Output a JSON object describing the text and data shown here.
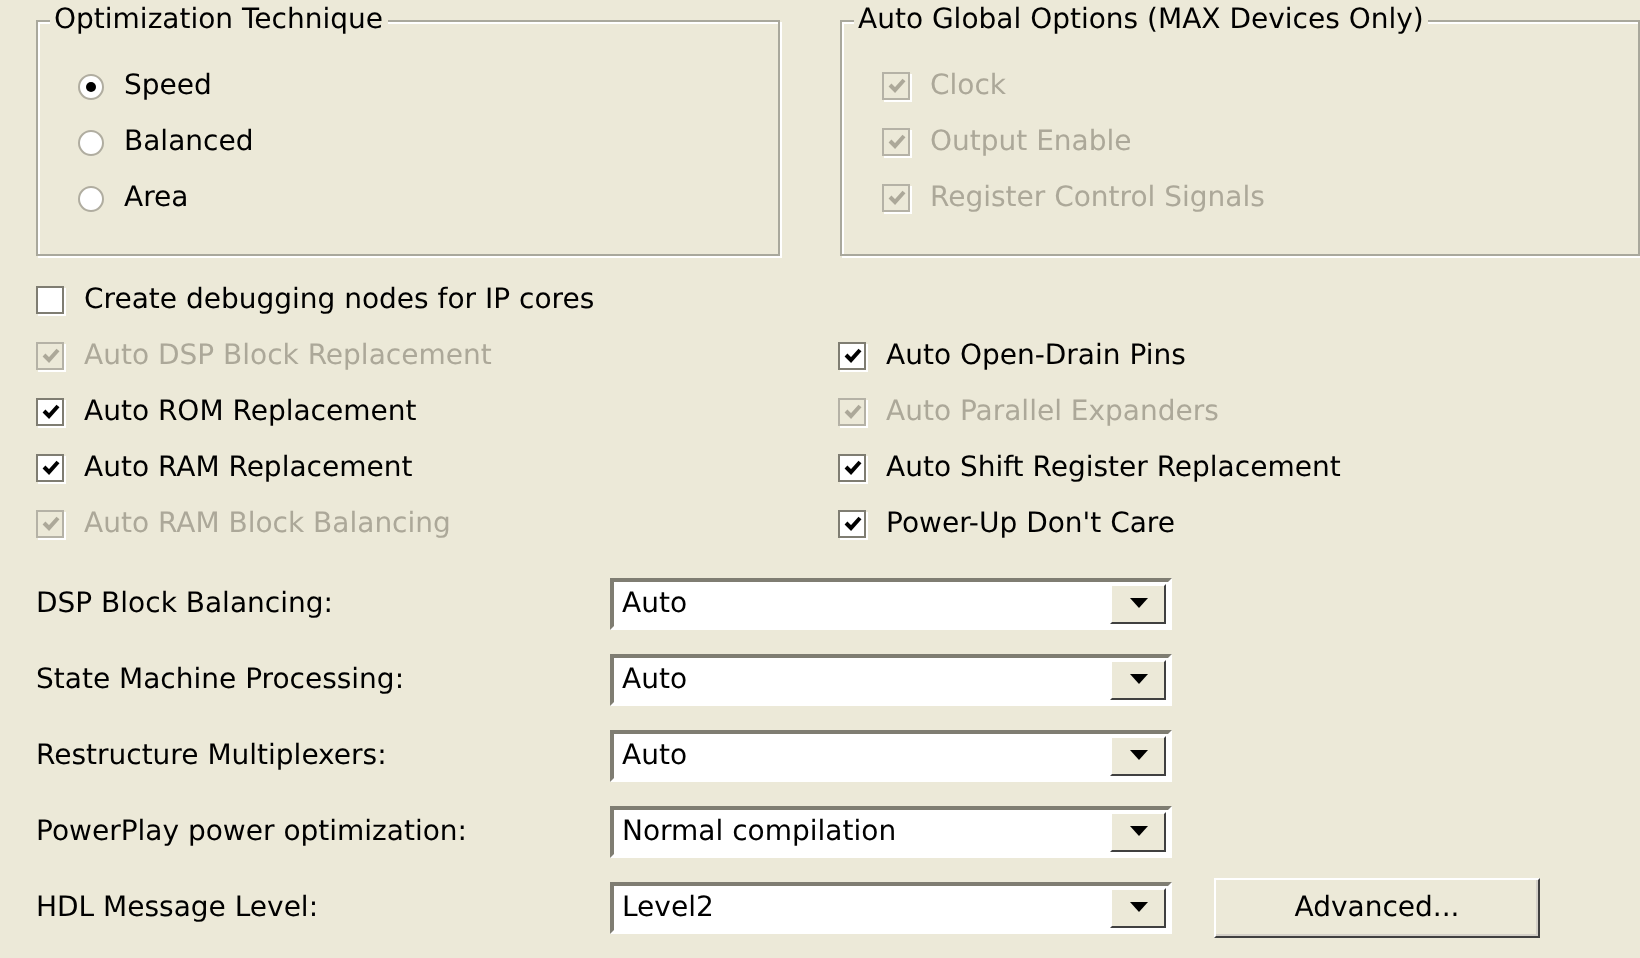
{
  "optimization_technique": {
    "title": "Optimization Technique",
    "options": [
      {
        "label": "Speed",
        "selected": true
      },
      {
        "label": "Balanced",
        "selected": false
      },
      {
        "label": "Area",
        "selected": false
      }
    ]
  },
  "auto_global_options": {
    "title": "Auto Global Options (MAX Devices Only)",
    "options": [
      {
        "label": "Clock",
        "checked": true,
        "disabled": true
      },
      {
        "label": "Output Enable",
        "checked": true,
        "disabled": true
      },
      {
        "label": "Register Control Signals",
        "checked": true,
        "disabled": true
      }
    ]
  },
  "debug_option": {
    "label": "Create debugging nodes for IP cores",
    "checked": false,
    "disabled": false
  },
  "options_left": [
    {
      "label": "Auto DSP Block Replacement",
      "checked": true,
      "disabled": true
    },
    {
      "label": "Auto ROM Replacement",
      "checked": true,
      "disabled": false
    },
    {
      "label": "Auto RAM Replacement",
      "checked": true,
      "disabled": false
    },
    {
      "label": "Auto RAM Block Balancing",
      "checked": true,
      "disabled": true
    }
  ],
  "options_right": [
    {
      "label": "Auto Open-Drain Pins",
      "checked": true,
      "disabled": false
    },
    {
      "label": "Auto Parallel Expanders",
      "checked": true,
      "disabled": true
    },
    {
      "label": "Auto Shift Register Replacement",
      "checked": true,
      "disabled": false
    },
    {
      "label": "Power-Up Don't Care",
      "checked": true,
      "disabled": false
    }
  ],
  "settings": [
    {
      "label": "DSP Block Balancing:",
      "value": "Auto"
    },
    {
      "label": "State Machine Processing:",
      "value": "Auto"
    },
    {
      "label": "Restructure Multiplexers:",
      "value": "Auto"
    },
    {
      "label": "PowerPlay power optimization:",
      "value": "Normal compilation"
    },
    {
      "label": "HDL Message Level:",
      "value": "Level2"
    }
  ],
  "advanced_button": "Advanced..."
}
